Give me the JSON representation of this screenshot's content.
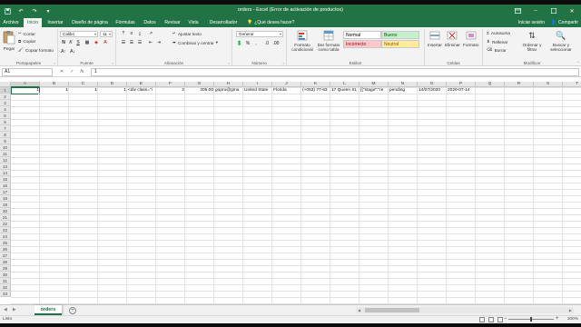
{
  "window": {
    "title": "orders - Excel (Error de activación de productos)",
    "controls": [
      "restore-down-icon",
      "minimize-icon",
      "maximize-icon",
      "close-icon"
    ]
  },
  "ribbon_tabs": [
    {
      "label": "Archivo",
      "active": false
    },
    {
      "label": "Inicio",
      "active": true
    },
    {
      "label": "Insertar",
      "active": false
    },
    {
      "label": "Diseño de página",
      "active": false
    },
    {
      "label": "Fórmulas",
      "active": false
    },
    {
      "label": "Datos",
      "active": false
    },
    {
      "label": "Revisar",
      "active": false
    },
    {
      "label": "Vista",
      "active": false
    },
    {
      "label": "Desarrollador",
      "active": false
    }
  ],
  "tellme": "¿Qué desea hacer?",
  "signin": "Iniciar sesión",
  "share": "Compartir",
  "ribbon": {
    "clipboard": {
      "paste": "Pegar",
      "cut": "Cortar",
      "copy": "Copiar",
      "format_painter": "Copiar formato",
      "label": "Portapapeles"
    },
    "font": {
      "name": "Calibri",
      "size": "11",
      "label": "Fuente"
    },
    "alignment": {
      "wrap": "Ajustar texto",
      "merge": "Combinar y centrar",
      "label": "Alineación"
    },
    "number": {
      "format": "General",
      "label": "Número"
    },
    "styles": {
      "conditional": "Formato condicional",
      "as_table": "Dar formato como tabla",
      "cells": [
        {
          "label": "Normal",
          "bg": "#ffffff",
          "fg": "#000000"
        },
        {
          "label": "Bueno",
          "bg": "#c6efce",
          "fg": "#006100"
        },
        {
          "label": "Incorrecto",
          "bg": "#ffc7ce",
          "fg": "#9c0006"
        },
        {
          "label": "Neutral",
          "bg": "#ffeb9c",
          "fg": "#9c5700"
        }
      ],
      "label": "Estilos"
    },
    "cells": {
      "insert": "Insertar",
      "delete": "Eliminar",
      "format": "Formato",
      "label": "Celdas"
    },
    "editing": {
      "autosum": "Autosuma",
      "fill": "Rellenar",
      "clear": "Borrar",
      "sort": "Ordenar y filtrar",
      "find": "Buscar y seleccionar",
      "label": "Modificar"
    }
  },
  "formula_bar": {
    "name_box": "A1",
    "value": "1"
  },
  "columns": [
    "A",
    "B",
    "C",
    "D",
    "E",
    "F",
    "G",
    "H",
    "I",
    "J",
    "K",
    "L",
    "M",
    "N",
    "O",
    "P",
    "Q",
    "R",
    "S",
    "T"
  ],
  "selected_cell": {
    "column": "A",
    "row": "1"
  },
  "row_count": 33,
  "row1": [
    {
      "col": "A",
      "value": "1",
      "num": true
    },
    {
      "col": "B",
      "value": "1",
      "num": true
    },
    {
      "col": "C",
      "value": "1",
      "num": true
    },
    {
      "col": "D",
      "value": "1",
      "num": true
    },
    {
      "col": "E",
      "value": "<div class=\"i",
      "num": false
    },
    {
      "col": "F",
      "value": "2",
      "num": true
    },
    {
      "col": "G",
      "value": "205.00",
      "num": true
    },
    {
      "col": "H",
      "value": "gopro@gma",
      "num": false
    },
    {
      "col": "I",
      "value": "United State",
      "num": false
    },
    {
      "col": "J",
      "value": "Florida",
      "num": false
    },
    {
      "col": "K",
      "value": "(+053) 77-63",
      "num": false
    },
    {
      "col": "L",
      "value": "17 Queen St,",
      "num": false
    },
    {
      "col": "M",
      "value": "[{\"stage\":\"re",
      "num": false
    },
    {
      "col": "N",
      "value": "pending",
      "num": false
    },
    {
      "col": "O",
      "value": "14/07/2020",
      "num": false
    },
    {
      "col": "P",
      "value": "2020-07-14",
      "num": false
    }
  ],
  "sheets": [
    {
      "name": "orders",
      "active": true
    }
  ],
  "status": {
    "text": "Listo",
    "zoom": "100%"
  },
  "colors": {
    "accent": "#217346"
  }
}
